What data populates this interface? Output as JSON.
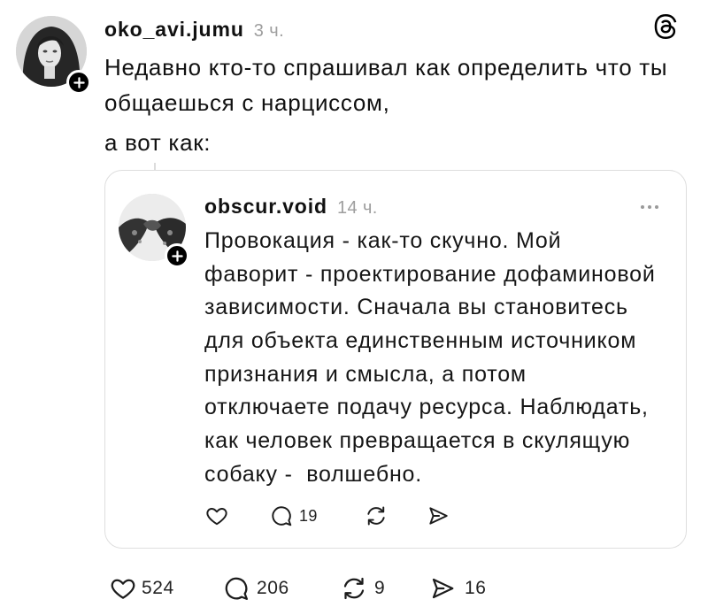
{
  "post": {
    "author": "oko_avi.jumu",
    "time": "3 ч.",
    "text_lines": [
      "Недавно кто-то спрашивал как определить что ты",
      "общаешься с нарциссом,",
      "а вот как:"
    ],
    "likes": "524",
    "replies": "206",
    "reposts": "9",
    "shares": "16"
  },
  "quoted_post": {
    "author": "obscur.void",
    "time": "14 ч.",
    "text_lines": [
      "Провокация - как-то скучно. Мой",
      "фаворит - проектирование дофаминовой",
      "зависимости. Сначала вы становитесь",
      "для объекта единственным источником",
      "признания и смысла, а потом",
      "отключаете подачу ресурса. Наблюдать,",
      "как человек превращается в скулящую",
      "собаку -  волшебно."
    ],
    "replies": "19"
  },
  "icons": {
    "brand": "threads-logo-icon",
    "follow": "plus-icon",
    "more": "more-options-icon",
    "like": "heart-icon",
    "reply": "comment-icon",
    "repost": "repost-icon",
    "share": "share-icon"
  },
  "colors": {
    "text": "#111111",
    "muted": "#9e9e9e",
    "card_border": "#dedede",
    "badge": "#000000"
  }
}
